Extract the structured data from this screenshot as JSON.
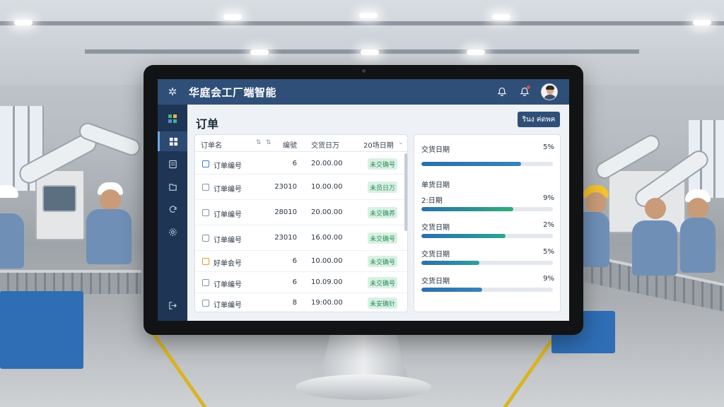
{
  "app": {
    "title": "华庭会工厂端智能",
    "logo_icon": "gear-cluster-icon"
  },
  "topbar": {
    "icons": [
      "bell-icon",
      "alert-bell-icon",
      "user-avatar"
    ]
  },
  "sidebar": {
    "items": [
      {
        "icon": "apps-grid-icon",
        "active": false
      },
      {
        "icon": "dashboard-icon",
        "active": true
      },
      {
        "icon": "document-icon",
        "active": false
      },
      {
        "icon": "folder-icon",
        "active": false
      },
      {
        "icon": "refresh-icon",
        "active": false
      },
      {
        "icon": "settings-icon",
        "active": false
      },
      {
        "icon": "logout-icon",
        "active": false
      }
    ]
  },
  "main": {
    "page_title": "订单",
    "primary_button": "รินง ค่ดพค"
  },
  "orders_table": {
    "headers": [
      "订单名",
      "编號",
      "交货日万",
      "20场日期"
    ],
    "rows": [
      {
        "name": "订单编号",
        "code": "6",
        "amount": "20.00.00",
        "status": "未交确号",
        "checkbox": "blue"
      },
      {
        "name": "订单编号",
        "code": "23010",
        "amount": "10.00.00",
        "status": "未员日万",
        "checkbox": "gray"
      },
      {
        "name": "订单编号",
        "code": "28010",
        "amount": "20.00.00",
        "status": "未交确养",
        "checkbox": "gray"
      },
      {
        "name": "订单编号",
        "code": "23010",
        "amount": "16.00.00",
        "status": "未交确号",
        "checkbox": "gray"
      },
      {
        "name": "好单会号",
        "code": "6",
        "amount": "10.00.00",
        "status": "未交确号",
        "checkbox": "orange"
      },
      {
        "name": "订单编号",
        "code": "6",
        "amount": "10.09.00",
        "status": "未交确号",
        "checkbox": "gray"
      },
      {
        "name": "订单编号",
        "code": "8",
        "amount": "19:00.00",
        "status": "未安确针",
        "checkbox": "gray"
      }
    ]
  },
  "delivery_progress": {
    "items": [
      {
        "label": "交货日期",
        "value": "5%",
        "fill": 0.76,
        "color": "#3a82b8"
      },
      {
        "label": "单货日期",
        "value": "",
        "fill": 0,
        "color": "#3a82b8"
      },
      {
        "label": "2:日期",
        "value": "9%",
        "fill": 0.7,
        "color": "#2fae7a"
      },
      {
        "label": "交货日期",
        "value": "2%",
        "fill": 0.64,
        "color": "#2da58f"
      },
      {
        "label": "交货日期",
        "value": "5%",
        "fill": 0.44,
        "color": "#2d9fa0"
      },
      {
        "label": "交货日期",
        "value": "9%",
        "fill": 0.46,
        "color": "#3a82b8"
      }
    ]
  },
  "colors": {
    "topbar": "#2f4f78",
    "sidebar": "#1f3556",
    "status_bg": "#d9f1e4",
    "status_text": "#2d8a58"
  }
}
